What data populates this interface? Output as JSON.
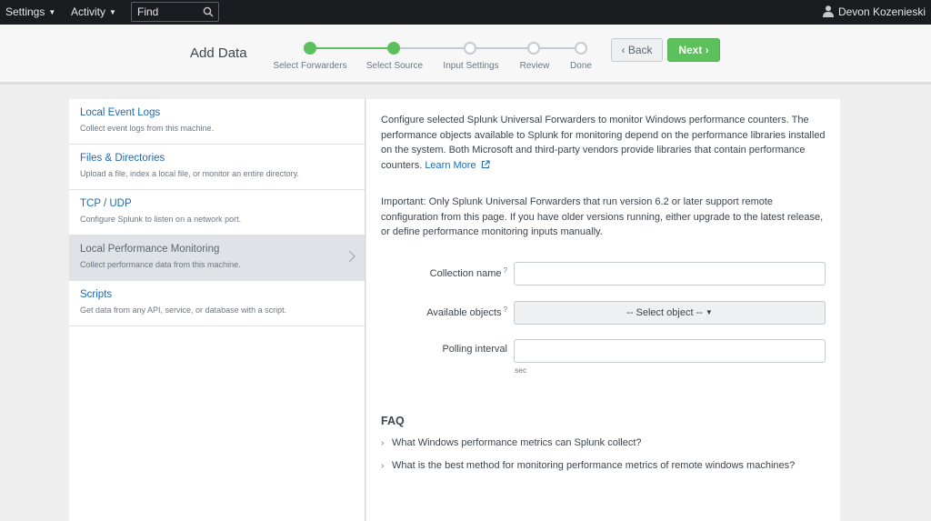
{
  "topbar": {
    "settings_label": "Settings",
    "activity_label": "Activity",
    "search_placeholder": "Find",
    "user_name": "Devon Kozenieski"
  },
  "wizard": {
    "title": "Add Data",
    "steps": [
      {
        "label": "Select Forwarders",
        "state": "done"
      },
      {
        "label": "Select Source",
        "state": "current"
      },
      {
        "label": "Input Settings",
        "state": "pending"
      },
      {
        "label": "Review",
        "state": "pending"
      },
      {
        "label": "Done",
        "state": "pending"
      }
    ],
    "back_label": "‹ Back",
    "next_label": "Next ›"
  },
  "sources": [
    {
      "title": "Local Event Logs",
      "desc": "Collect event logs from this machine."
    },
    {
      "title": "Files & Directories",
      "desc": "Upload a file, index a local file, or monitor an entire directory."
    },
    {
      "title": "TCP / UDP",
      "desc": "Configure Splunk to listen on a network port."
    },
    {
      "title": "Local Performance Monitoring",
      "desc": "Collect performance data from this machine.",
      "selected": true
    },
    {
      "title": "Scripts",
      "desc": "Get data from any API, service, or database with a script."
    }
  ],
  "main": {
    "intro_text": "Configure selected Splunk Universal Forwarders to monitor Windows performance counters. The performance objects available to Splunk for monitoring depend on the performance libraries installed on the system. Both Microsoft and third-party vendors provide libraries that contain performance counters.",
    "learn_more_label": "Learn More",
    "important_text": "Important: Only Splunk Universal Forwarders that run version 6.2 or later support remote configuration from this page. If you have older versions running, either upgrade to the latest release, or define performance monitoring inputs manually.",
    "collection_name_label": "Collection name",
    "collection_name_value": "",
    "available_objects_label": "Available objects",
    "select_object_label": "-- Select object --",
    "polling_interval_label": "Polling interval",
    "polling_interval_value": "",
    "polling_unit": "sec",
    "help_mark": "?"
  },
  "faq": {
    "title": "FAQ",
    "items": [
      "What Windows performance metrics can Splunk collect?",
      "What is the best method for monitoring performance metrics of remote windows machines?"
    ]
  },
  "colors": {
    "accent_green": "#5cc05c",
    "link_blue": "#1e6bb0",
    "topbar_bg": "#1a1c20"
  }
}
